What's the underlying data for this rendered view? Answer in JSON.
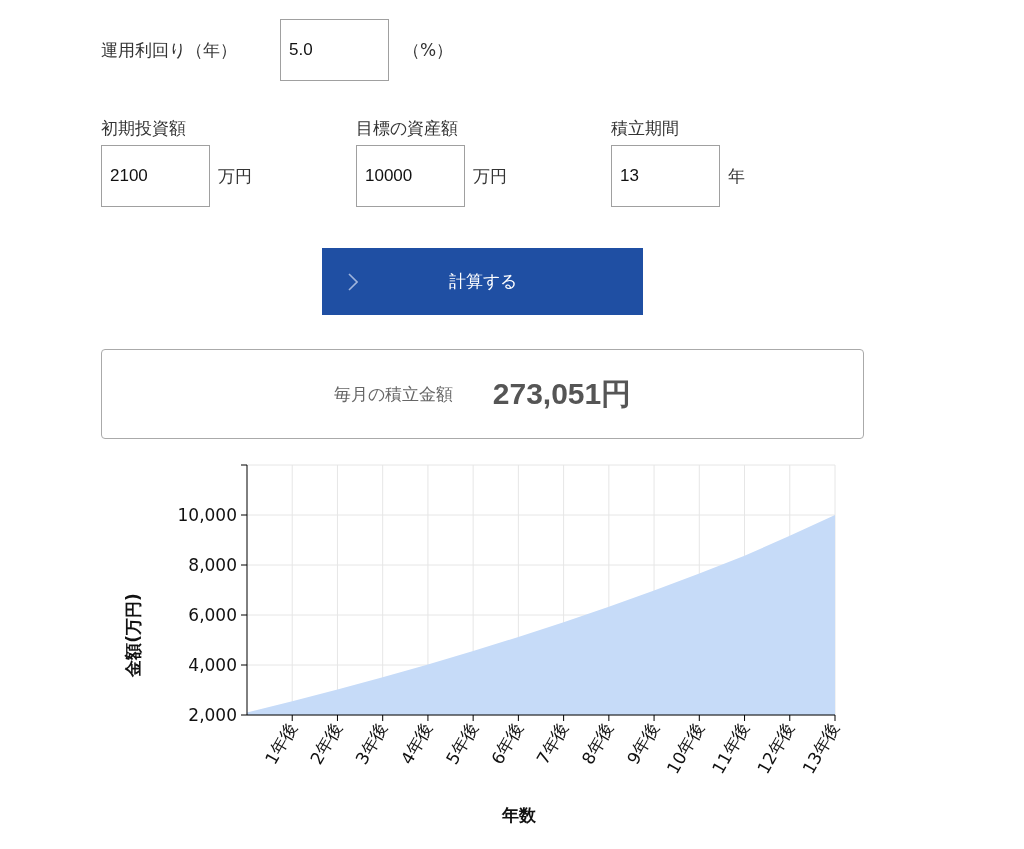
{
  "rate": {
    "label": "運用利回り（年）",
    "value": "5.0",
    "unit": "（%）"
  },
  "fields": [
    {
      "label": "初期投資額",
      "value": "2100",
      "unit": "万円"
    },
    {
      "label": "目標の資産額",
      "value": "10000",
      "unit": "万円"
    },
    {
      "label": "積立期間",
      "value": "13",
      "unit": "年"
    }
  ],
  "calculate_button": {
    "label": "計算する"
  },
  "result": {
    "label": "毎月の積立金額",
    "value": "273,051円"
  },
  "chart": {
    "chart_data": {
      "type": "area",
      "xlabel": "年数",
      "ylabel": "金額(万円)",
      "x": [
        0,
        1,
        2,
        3,
        4,
        5,
        6,
        7,
        8,
        9,
        10,
        11,
        12,
        13
      ],
      "grid": true,
      "series": [
        {
          "color": "#c6dbf8",
          "values": [
            2100,
            2550,
            3020,
            3510,
            4020,
            4560,
            5120,
            5710,
            6330,
            6980,
            7660,
            8370,
            9170,
            10000
          ]
        }
      ],
      "xlim": [
        0,
        13
      ],
      "ylim": [
        2000,
        12000
      ],
      "xticks": [
        {
          "value": 1,
          "label": "1年後"
        },
        {
          "value": 2,
          "label": "2年後"
        },
        {
          "value": 3,
          "label": "3年後"
        },
        {
          "value": 4,
          "label": "4年後"
        },
        {
          "value": 5,
          "label": "5年後"
        },
        {
          "value": 6,
          "label": "6年後"
        },
        {
          "value": 7,
          "label": "7年後"
        },
        {
          "value": 8,
          "label": "8年後"
        },
        {
          "value": 9,
          "label": "9年後"
        },
        {
          "value": 10,
          "label": "10年後"
        },
        {
          "value": 11,
          "label": "11年後"
        },
        {
          "value": 12,
          "label": "12年後"
        },
        {
          "value": 13,
          "label": "13年後"
        }
      ],
      "yticks": [
        {
          "value": 2000,
          "label": "2,000"
        },
        {
          "value": 4000,
          "label": "4,000"
        },
        {
          "value": 6000,
          "label": "6,000"
        },
        {
          "value": 8000,
          "label": "8,000"
        },
        {
          "value": 10000,
          "label": "10,000"
        }
      ]
    }
  }
}
